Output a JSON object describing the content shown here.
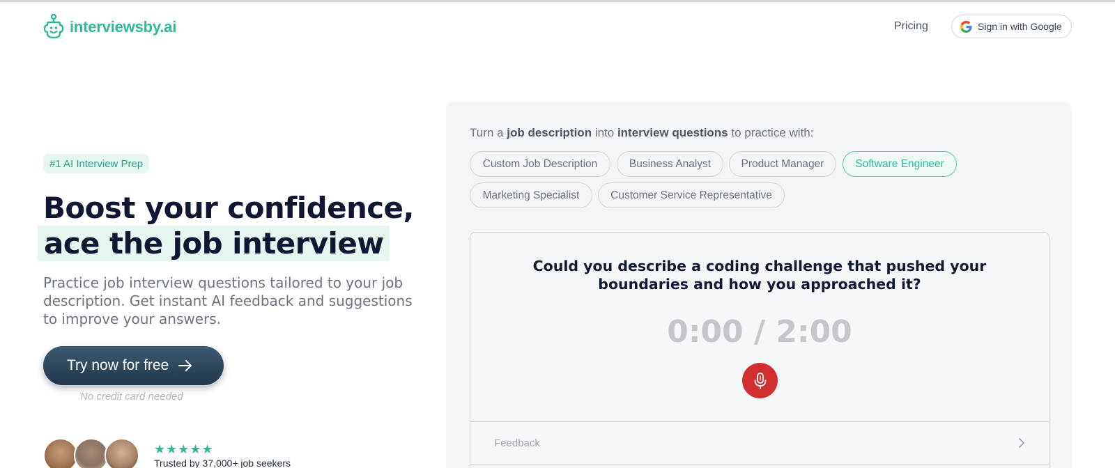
{
  "header": {
    "logo_text": "interviewsby.ai",
    "nav_pricing": "Pricing",
    "google_button": "Sign in with Google"
  },
  "hero": {
    "badge": "#1 AI Interview Prep",
    "headline_line1": "Boost your confidence,",
    "headline_line2": "ace the job interview",
    "subtext": "Practice job interview questions tailored to your job description. Get instant AI feedback and suggestions to improve your answers.",
    "cta_label": "Try now for free",
    "cta_note": "No credit card needed",
    "rating_stars": "★★★★★",
    "rating_value": 5,
    "trusted_text": "Trusted by 37,000+ job seekers"
  },
  "practice": {
    "prompt_prefix": "Turn a ",
    "prompt_bold1": "job description",
    "prompt_mid": " into ",
    "prompt_bold2": "interview questions",
    "prompt_suffix": " to practice with:",
    "roles": [
      "Custom Job Description",
      "Business Analyst",
      "Product Manager",
      "Software Engineer",
      "Marketing Specialist",
      "Customer Service Representative"
    ],
    "selected_role": "Software Engineer",
    "question": "Could you describe a coding challenge that pushed your boundaries and how you approached it?",
    "timer": "0:00 / 2:00",
    "feedback_label": "Feedback"
  },
  "colors": {
    "brand_green": "#2fb89a",
    "navy_text": "#111633",
    "cta_dark": "#22384b",
    "record_red": "#d12f2f"
  },
  "icons": [
    "robot-logo-icon",
    "google-g-icon",
    "arrow-right-icon",
    "microphone-icon",
    "chevron-right-icon",
    "star-icon"
  ]
}
